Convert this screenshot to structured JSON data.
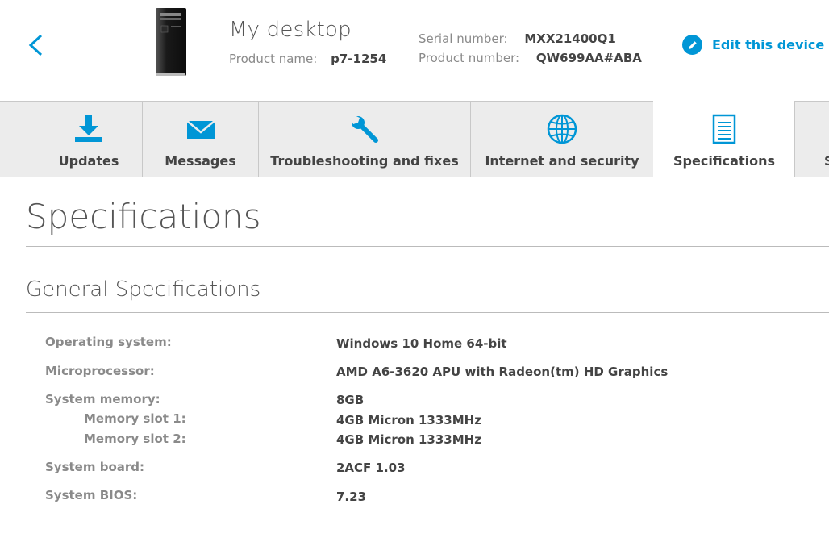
{
  "header": {
    "device_name": "My desktop",
    "product_name_label": "Product name:",
    "product_name_value": "p7-1254",
    "serial_number_label": "Serial number:",
    "serial_number_value": "MXX21400Q1",
    "product_number_label": "Product number:",
    "product_number_value": "QW699AA#ABA",
    "edit_label": "Edit this device"
  },
  "tabs": [
    {
      "label": "Updates",
      "icon": "download-icon"
    },
    {
      "label": "Messages",
      "icon": "envelope-icon"
    },
    {
      "label": "Troubleshooting and fixes",
      "icon": "wrench-icon"
    },
    {
      "label": "Internet and security",
      "icon": "globe-icon"
    },
    {
      "label": "Specifications",
      "icon": "document-icon",
      "active": true
    },
    {
      "label": "S",
      "icon": "partial-tab"
    }
  ],
  "page": {
    "title": "Specifications",
    "section_title": "General Specifications"
  },
  "specs": [
    {
      "label": "Operating system:",
      "value": "Windows 10 Home 64-bit"
    },
    {
      "label": "Microprocessor:",
      "value": "AMD A6-3620 APU with Radeon(tm) HD Graphics"
    },
    {
      "label": "System memory:",
      "value": "8GB"
    },
    {
      "label": "Memory slot 1:",
      "value": "4GB  Micron 1333MHz"
    },
    {
      "label": "Memory slot 2:",
      "value": "4GB  Micron 1333MHz"
    },
    {
      "label": "System board:",
      "value": "2ACF 1.03"
    },
    {
      "label": "System BIOS:",
      "value": "7.23"
    }
  ],
  "colors": {
    "accent": "#0096d6",
    "tab_bg": "#ececec",
    "label": "#8a8a8a",
    "value": "#444444"
  }
}
